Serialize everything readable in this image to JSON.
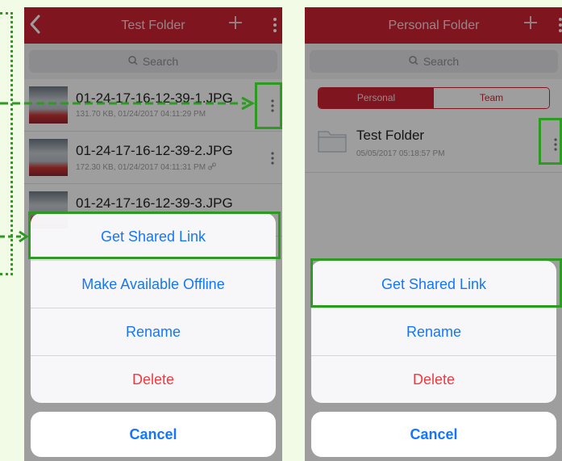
{
  "left": {
    "title": "Test Folder",
    "search_placeholder": "Search",
    "files": [
      {
        "name": "01-24-17-16-12-39-1.JPG",
        "meta": "131.70 KB, 01/24/2017 04:11:29 PM"
      },
      {
        "name": "01-24-17-16-12-39-2.JPG",
        "meta": "172.30 KB, 01/24/2017 04:11:31 PM"
      },
      {
        "name": "01-24-17-16-12-39-3.JPG",
        "meta": ""
      }
    ],
    "actions": [
      "Get Shared Link",
      "Make Available Offline",
      "Rename",
      "Delete"
    ],
    "cancel": "Cancel"
  },
  "right": {
    "title": "Personal Folder",
    "search_placeholder": "Search",
    "segments": [
      "Personal",
      "Team"
    ],
    "folder": {
      "name": "Test Folder",
      "meta": "05/05/2017 05:18:57 PM"
    },
    "actions": [
      "Get Shared Link",
      "Rename",
      "Delete"
    ],
    "cancel": "Cancel"
  },
  "colors": {
    "brand_red": "#cc2233",
    "action_blue": "#1477f8",
    "destructive_red": "#ef3b40",
    "annotation_green": "#2d9a22"
  },
  "icons": [
    "back-arrow-icon",
    "plus-icon",
    "more-vertical-icon",
    "search-icon",
    "folder-icon",
    "link-icon"
  ]
}
